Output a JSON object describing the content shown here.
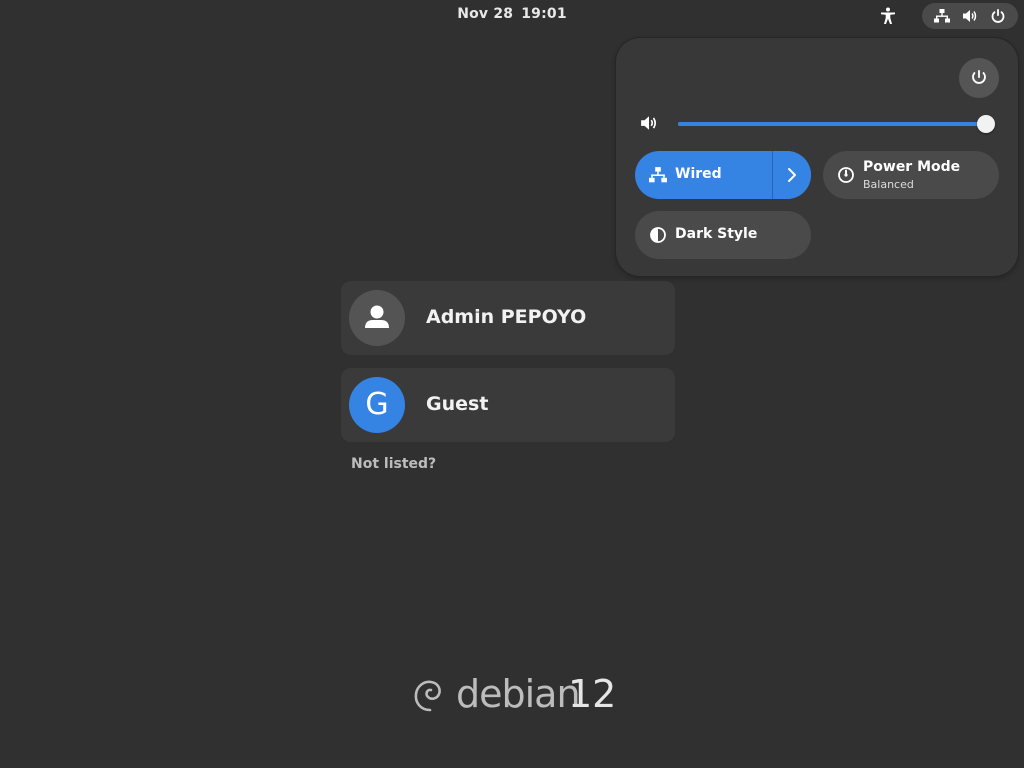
{
  "topbar": {
    "date": "Nov 28",
    "time": "19:01",
    "icons": [
      "accessibility-icon",
      "network-wired-icon",
      "volume-icon",
      "power-icon"
    ]
  },
  "quick_settings": {
    "power_button_icon": "power-icon",
    "volume": {
      "icon": "volume-icon",
      "level": 1.0
    },
    "toggles": {
      "wired": {
        "label": "Wired",
        "icon": "network-wired-icon",
        "active": true,
        "arrow_icon": "chevron-right-icon"
      },
      "power_mode": {
        "label": "Power Mode",
        "subtitle": "Balanced",
        "icon": "power-profile-icon",
        "active": false
      },
      "dark_style": {
        "label": "Dark Style",
        "icon": "dark-style-icon",
        "active": false
      }
    }
  },
  "users": [
    {
      "name": "Admin PEPOYO",
      "avatar": "user-icon"
    },
    {
      "name": "Guest",
      "avatar_letter": "G"
    }
  ],
  "not_listed": "Not listed?",
  "logo": {
    "wordmark": "debian",
    "version": "12"
  },
  "colors": {
    "background": "#303030",
    "accent": "#3584e4",
    "panel": "#383838",
    "toggle": "#4a4a4a"
  }
}
